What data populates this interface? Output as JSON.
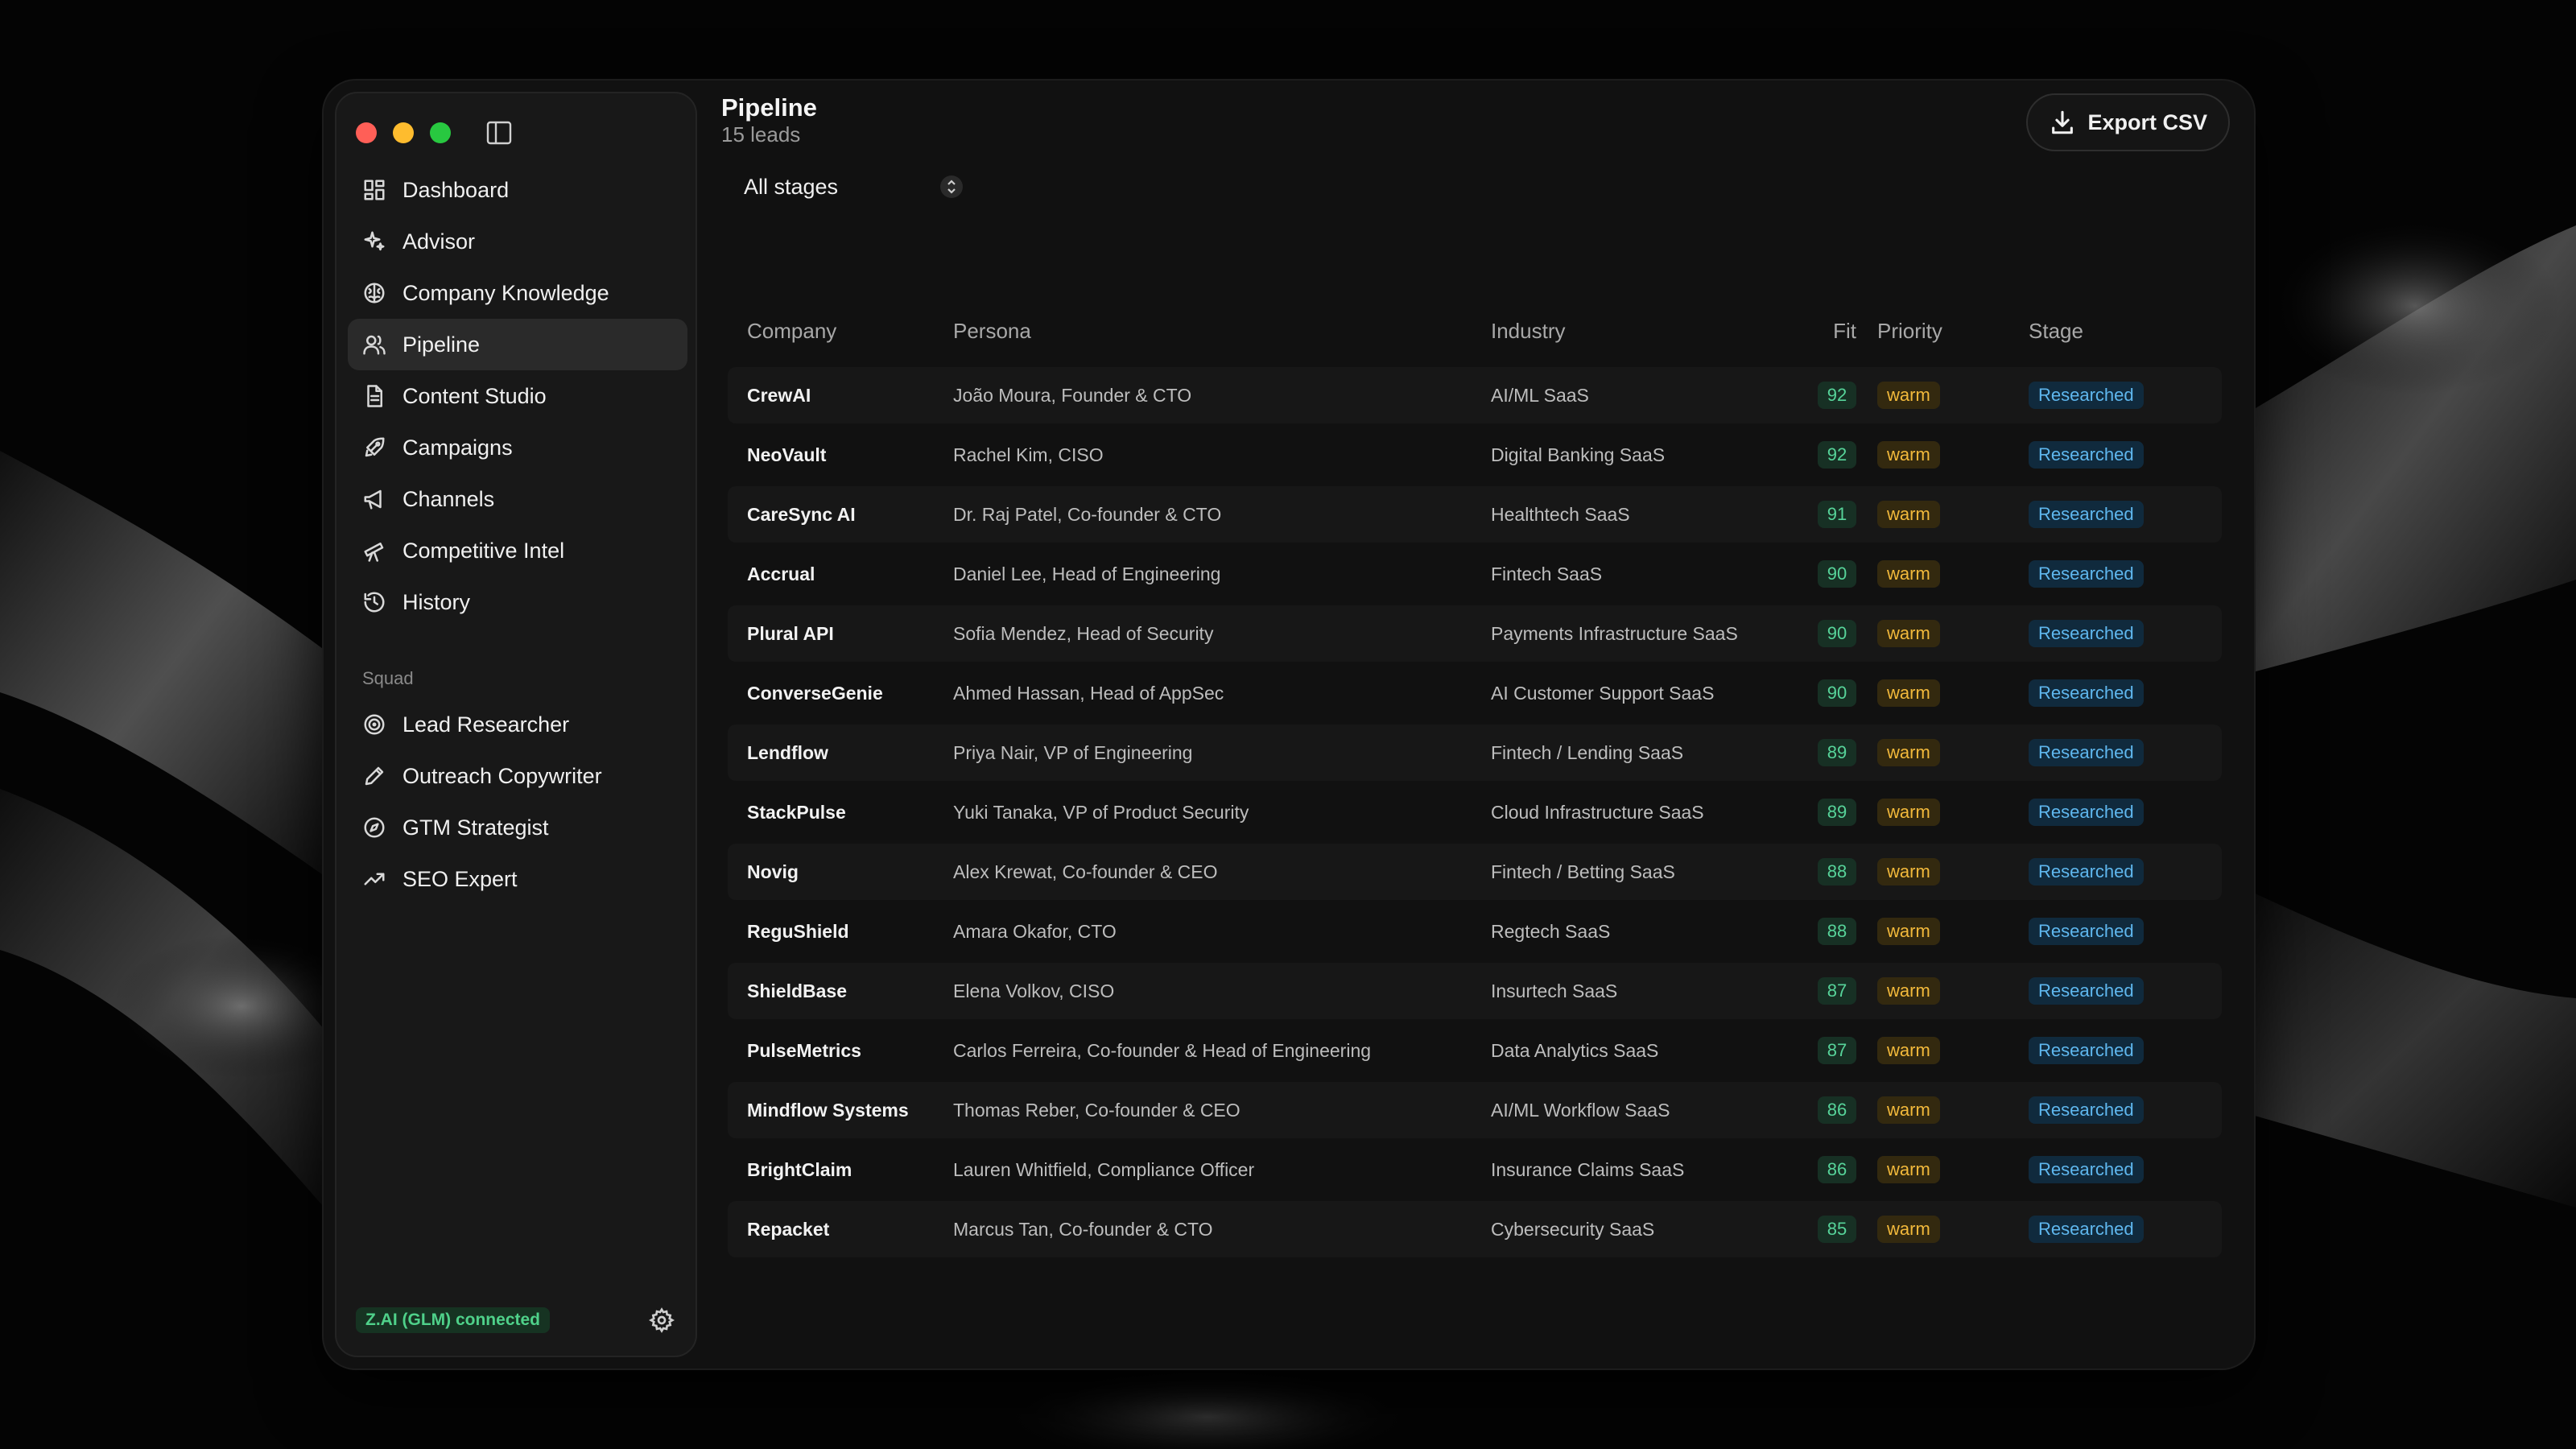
{
  "window": {
    "traffic": [
      "close",
      "minimize",
      "zoom"
    ]
  },
  "sidebar": {
    "items": [
      {
        "label": "Dashboard",
        "icon": "grid-icon"
      },
      {
        "label": "Advisor",
        "icon": "sparkles-icon"
      },
      {
        "label": "Company Knowledge",
        "icon": "brain-icon"
      },
      {
        "label": "Pipeline",
        "icon": "users-icon",
        "active": true
      },
      {
        "label": "Content Studio",
        "icon": "document-icon"
      },
      {
        "label": "Campaigns",
        "icon": "rocket-icon"
      },
      {
        "label": "Channels",
        "icon": "megaphone-icon"
      },
      {
        "label": "Competitive Intel",
        "icon": "telescope-icon"
      },
      {
        "label": "History",
        "icon": "history-icon"
      }
    ],
    "section_label": "Squad",
    "squad": [
      {
        "label": "Lead Researcher",
        "icon": "target-icon"
      },
      {
        "label": "Outreach Copywriter",
        "icon": "pen-icon"
      },
      {
        "label": "GTM Strategist",
        "icon": "compass-icon"
      },
      {
        "label": "SEO Expert",
        "icon": "trending-up-icon"
      }
    ],
    "status": "Z.AI (GLM) connected"
  },
  "main": {
    "title": "Pipeline",
    "subtitle": "15 leads",
    "export_label": "Export CSV",
    "stage_filter": "All stages",
    "columns": {
      "company": "Company",
      "persona": "Persona",
      "industry": "Industry",
      "fit": "Fit",
      "priority": "Priority",
      "stage": "Stage"
    },
    "rows": [
      {
        "company": "CrewAI",
        "persona": "João Moura, Founder & CTO",
        "industry": "AI/ML SaaS",
        "fit": "92",
        "priority": "warm",
        "stage": "Researched"
      },
      {
        "company": "NeoVault",
        "persona": "Rachel Kim, CISO",
        "industry": "Digital Banking SaaS",
        "fit": "92",
        "priority": "warm",
        "stage": "Researched"
      },
      {
        "company": "CareSync AI",
        "persona": "Dr. Raj Patel, Co-founder & CTO",
        "industry": "Healthtech SaaS",
        "fit": "91",
        "priority": "warm",
        "stage": "Researched"
      },
      {
        "company": "Accrual",
        "persona": "Daniel Lee, Head of Engineering",
        "industry": "Fintech SaaS",
        "fit": "90",
        "priority": "warm",
        "stage": "Researched"
      },
      {
        "company": "Plural API",
        "persona": "Sofia Mendez, Head of Security",
        "industry": "Payments Infrastructure SaaS",
        "fit": "90",
        "priority": "warm",
        "stage": "Researched"
      },
      {
        "company": "ConverseGenie",
        "persona": "Ahmed Hassan, Head of AppSec",
        "industry": "AI Customer Support SaaS",
        "fit": "90",
        "priority": "warm",
        "stage": "Researched"
      },
      {
        "company": "Lendflow",
        "persona": "Priya Nair, VP of Engineering",
        "industry": "Fintech / Lending SaaS",
        "fit": "89",
        "priority": "warm",
        "stage": "Researched"
      },
      {
        "company": "StackPulse",
        "persona": "Yuki Tanaka, VP of Product Security",
        "industry": "Cloud Infrastructure SaaS",
        "fit": "89",
        "priority": "warm",
        "stage": "Researched"
      },
      {
        "company": "Novig",
        "persona": "Alex Krewat, Co-founder & CEO",
        "industry": "Fintech / Betting SaaS",
        "fit": "88",
        "priority": "warm",
        "stage": "Researched"
      },
      {
        "company": "ReguShield",
        "persona": "Amara Okafor, CTO",
        "industry": "Regtech SaaS",
        "fit": "88",
        "priority": "warm",
        "stage": "Researched"
      },
      {
        "company": "ShieldBase",
        "persona": "Elena Volkov, CISO",
        "industry": "Insurtech SaaS",
        "fit": "87",
        "priority": "warm",
        "stage": "Researched"
      },
      {
        "company": "PulseMetrics",
        "persona": "Carlos Ferreira, Co-founder & Head of Engineering",
        "industry": "Data Analytics SaaS",
        "fit": "87",
        "priority": "warm",
        "stage": "Researched"
      },
      {
        "company": "Mindflow Systems",
        "persona": "Thomas Reber, Co-founder & CEO",
        "industry": "AI/ML Workflow SaaS",
        "fit": "86",
        "priority": "warm",
        "stage": "Researched"
      },
      {
        "company": "BrightClaim",
        "persona": "Lauren Whitfield, Compliance Officer",
        "industry": "Insurance Claims SaaS",
        "fit": "86",
        "priority": "warm",
        "stage": "Researched"
      },
      {
        "company": "Repacket",
        "persona": "Marcus Tan, Co-founder & CTO",
        "industry": "Cybersecurity SaaS",
        "fit": "85",
        "priority": "warm",
        "stage": "Researched"
      }
    ]
  },
  "colors": {
    "fit": "#57d49a",
    "warm": "#f2b93b",
    "stage": "#5fb7ee",
    "connected": "#4fd18a"
  }
}
